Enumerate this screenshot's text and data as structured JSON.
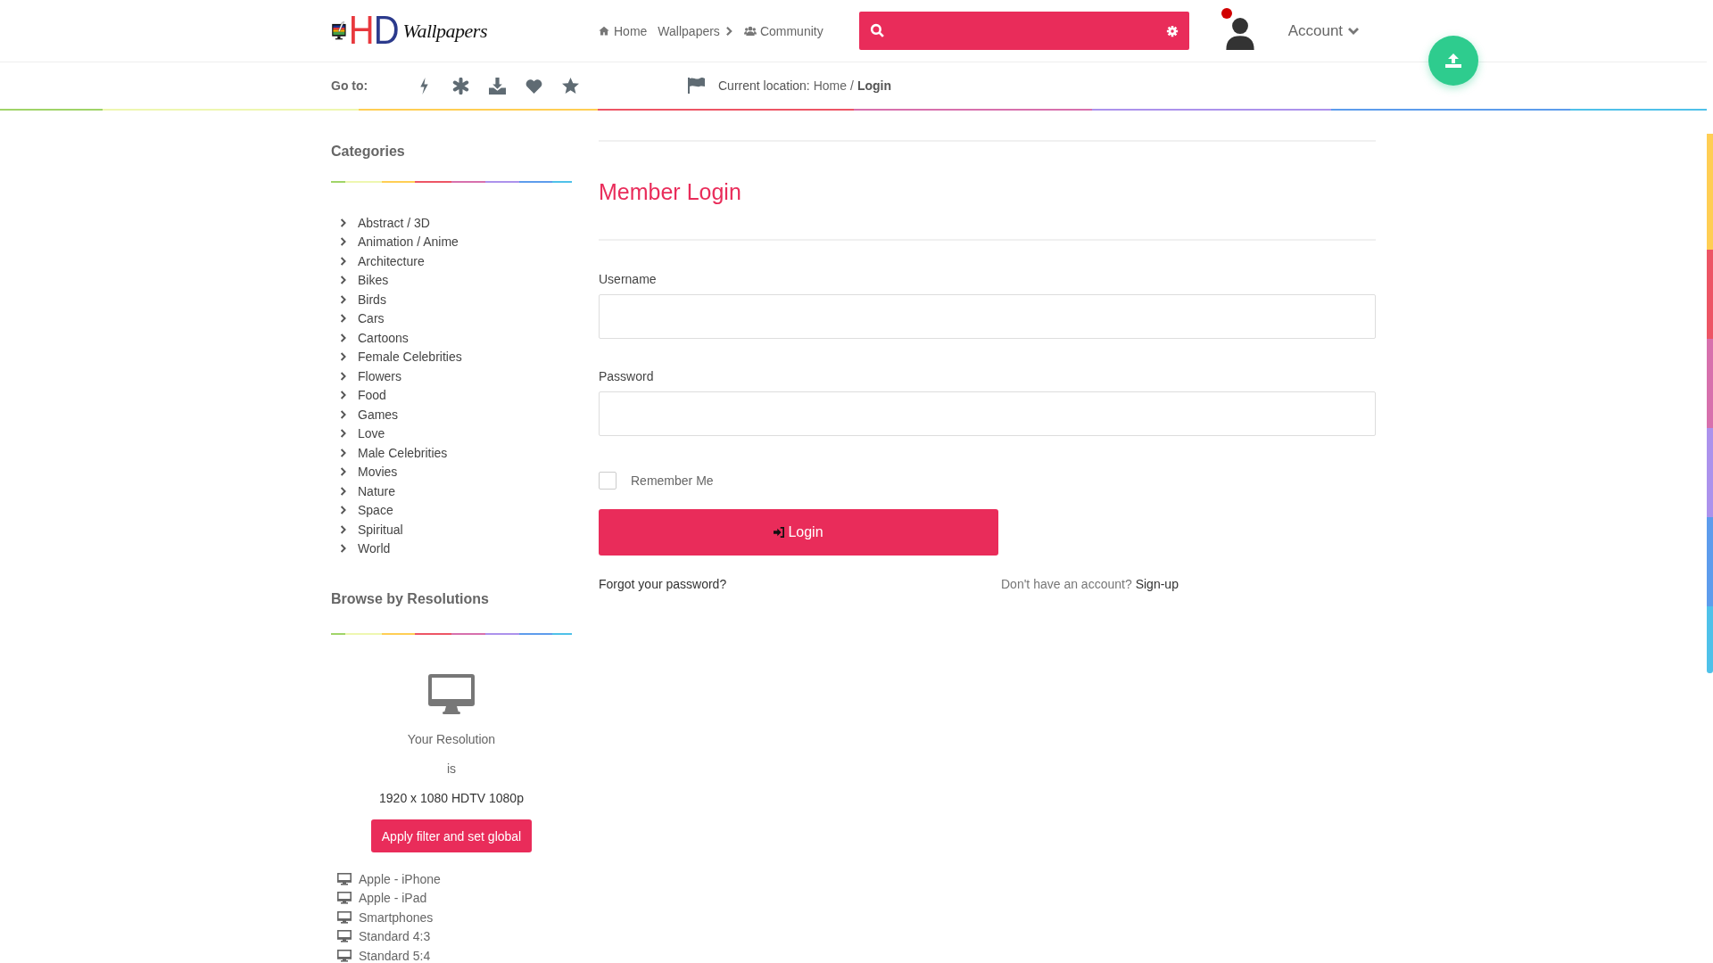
{
  "header": {
    "logo": {
      "mark": "HD",
      "script": "Wallpapers"
    },
    "nav": [
      {
        "label": "Home",
        "chevron": false
      },
      {
        "label": "Wallpapers",
        "chevron": true
      },
      {
        "label": "Community",
        "chevron": false
      }
    ],
    "account": {
      "label": "Account",
      "notification": true
    }
  },
  "subheader": {
    "goto_label": "Go to:",
    "location_label": "Current location:",
    "separator": "/",
    "crumbs": [
      {
        "label": "Home",
        "current": false
      },
      {
        "label": "Login",
        "current": true
      }
    ]
  },
  "sidebar": {
    "categories": {
      "title": "Categories",
      "items": [
        "Abstract / 3D",
        "Animation / Anime",
        "Architecture",
        "Bikes",
        "Birds",
        "Cars",
        "Cartoons",
        "Female Celebrities",
        "Flowers",
        "Food",
        "Games",
        "Love",
        "Male Celebrities",
        "Movies",
        "Nature",
        "Space",
        "Spiritual",
        "World"
      ]
    },
    "resolutions": {
      "title": "Browse by Resolutions",
      "caption": "Your Resolution",
      "joiner": "is",
      "value": "1920 x 1080 HDTV 1080p",
      "button": "Apply filter and set global",
      "items": [
        "Apple - iPhone",
        "Apple - iPad",
        "Smartphones",
        "Standard 4:3",
        "Standard 5:4"
      ]
    }
  },
  "login": {
    "title": "Member Login",
    "fields": [
      {
        "label": "Username"
      },
      {
        "label": "Password"
      }
    ],
    "remember": {
      "label": "Remember Me",
      "checked": false
    },
    "button": "Login",
    "forgot": "Forgot your password?",
    "signup_prompt": "Don't have an account?",
    "signup_link": "Sign-up"
  }
}
